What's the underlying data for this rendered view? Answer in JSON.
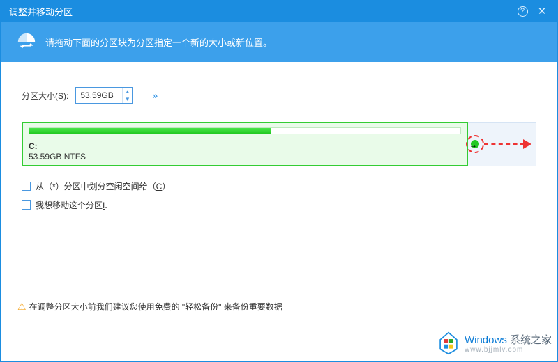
{
  "titlebar": {
    "title": "调整并移动分区",
    "help_glyph": "?",
    "close_glyph": "✕"
  },
  "banner": {
    "text": "请拖动下面的分区块为分区指定一个新的大小或新位置。"
  },
  "size_field": {
    "label": "分区大小(S):",
    "value": "53.59GB",
    "expand_glyph": "»"
  },
  "partition": {
    "drive_label": "C:",
    "info": "53.59GB NTFS",
    "fill_percent": 56
  },
  "checkboxes": {
    "allocate_prefix": "从（*）分区中划分空闲空间给（",
    "allocate_drive": "C",
    "allocate_suffix": "）",
    "move_text": "我想移动这个分区",
    "info_link": "I",
    "period": "."
  },
  "warning": {
    "icon": "⚠",
    "text": "在调整分区大小前我们建议您使用免费的 \"轻松备份\" 来备份重要数据"
  },
  "watermark": {
    "brand_en": "Windows",
    "brand_cn": " 系统之家",
    "url": "www.bjjmlv.com"
  }
}
